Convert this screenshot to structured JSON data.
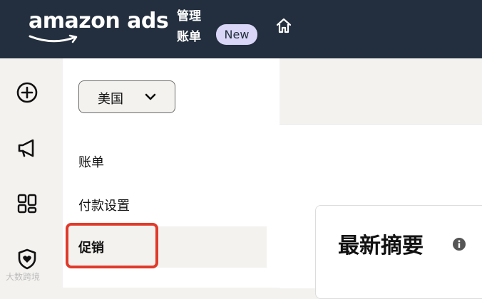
{
  "header": {
    "logo_text": "amazon ads",
    "nav_line1": "管理",
    "nav_line2": "账单",
    "badge": "New",
    "home_icon": "home-icon"
  },
  "rail": {
    "icons": [
      "plus-circle-icon",
      "megaphone-icon",
      "dashboard-grid-icon",
      "shield-heart-icon"
    ]
  },
  "subnav": {
    "country": "美国",
    "items": [
      "账单",
      "付款设置",
      "促销"
    ],
    "active_index": 2
  },
  "main": {
    "card_title": "最新摘要"
  },
  "watermark": "大数跨境",
  "colors": {
    "header_bg": "#232f3e",
    "badge_bg": "#d9d6f7",
    "highlight": "#e03a2a"
  }
}
